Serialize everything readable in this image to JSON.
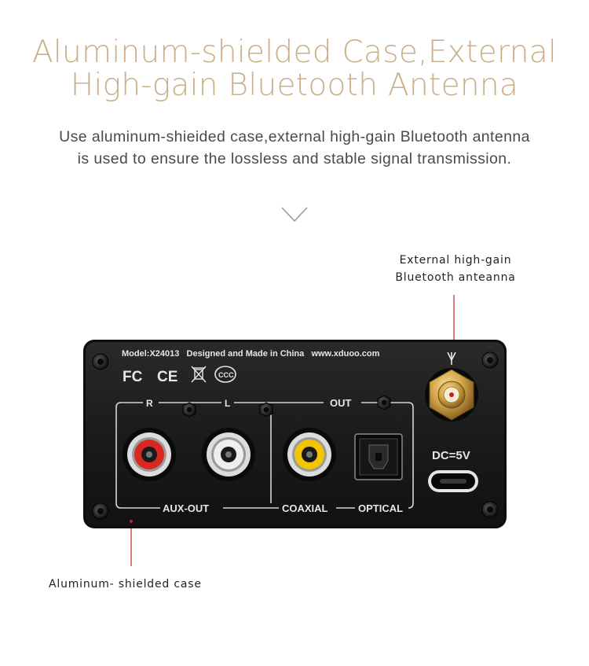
{
  "header": {
    "title_line1": "Aluminum-shielded Case,External",
    "title_line2": "High-gain Bluetooth Antenna",
    "subtitle_line1": "Use aluminum-shieided case,external high-gain Bluetooth antenna",
    "subtitle_line2": "is used to ensure the lossless and stable signal transmission."
  },
  "callouts": {
    "antenna_line1": "External high-gain",
    "antenna_line2": "Bluetooth anteanna",
    "case_label": "Aluminum- shielded case"
  },
  "device": {
    "top_text": "Model:X24013   Designed and Made in China   www.xduoo.com",
    "cert_fc": "FC",
    "cert_ce": "CE",
    "label_r": "R",
    "label_l": "L",
    "label_out": "OUT",
    "label_aux_out": "AUX-OUT",
    "label_coaxial": "COAXIAL",
    "label_optical": "OPTICAL",
    "label_dc": "DC=5V"
  },
  "colors": {
    "title": "#c9b08a",
    "body_text": "#4a4a4a",
    "panel": "#1c1c1c",
    "callout_line": "#c0202a",
    "rca_red": "#d8281f",
    "rca_white": "#e8e8e8",
    "rca_yellow": "#f2c500",
    "gold": "#d4a64a"
  }
}
